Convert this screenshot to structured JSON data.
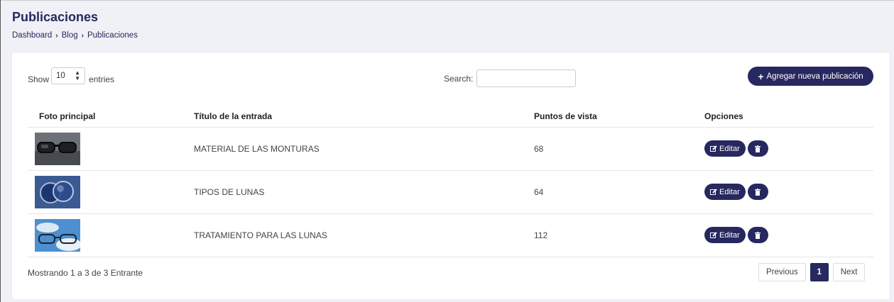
{
  "page": {
    "title": "Publicaciones",
    "breadcrumb": [
      "Dashboard",
      "Blog",
      "Publicaciones"
    ]
  },
  "controls": {
    "show_label": "Show",
    "entries_label": "entries",
    "page_length": "10",
    "search_label": "Search:",
    "search_value": "",
    "add_button": "Agregar nueva publicación"
  },
  "table": {
    "headers": [
      "Foto principal",
      "Título de la entrada",
      "Puntos de vista",
      "Opciones"
    ],
    "rows": [
      {
        "thumb_icon": "eyeglasses-photo",
        "title": "MATERIAL DE LAS MONTURAS",
        "views": "68"
      },
      {
        "thumb_icon": "lenses-photo",
        "title": "TIPOS DE LUNAS",
        "views": "64"
      },
      {
        "thumb_icon": "glasses-sky-photo",
        "title": "TRATAMIENTO PARA LAS LUNAS",
        "views": "112"
      }
    ],
    "edit_label": "Editar"
  },
  "footer": {
    "info": "Mostrando 1 a 3 de 3 Entrante",
    "previous": "Previous",
    "current_page": "1",
    "next": "Next"
  },
  "colors": {
    "primary": "#26285f",
    "background": "#f0f1f6"
  }
}
